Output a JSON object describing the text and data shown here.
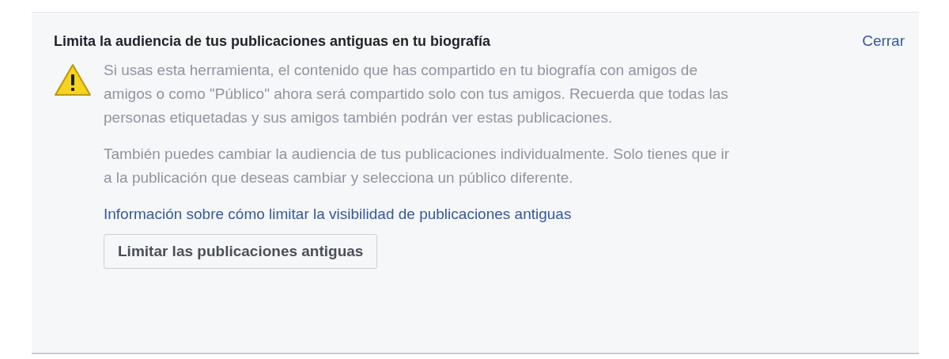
{
  "notice": {
    "title": "Limita la audiencia de tus publicaciones antiguas en tu biografía",
    "close_link": "Cerrar",
    "paragraphs": [
      "Si usas esta herramienta, el contenido que has compartido en tu biografía con amigos de amigos o como \"Público\" ahora será compartido solo con tus amigos. Recuerda que todas las personas etiquetadas y sus amigos también podrán ver estas publicaciones.",
      "También puedes cambiar la audiencia de tus publicaciones individualmente. Solo tienes que ir a la publicación que deseas cambiar y selecciona un público diferente."
    ],
    "info_link": "Información sobre cómo limitar la visibilidad de publicaciones antiguas",
    "button": "Limitar las publicaciones antiguas"
  }
}
